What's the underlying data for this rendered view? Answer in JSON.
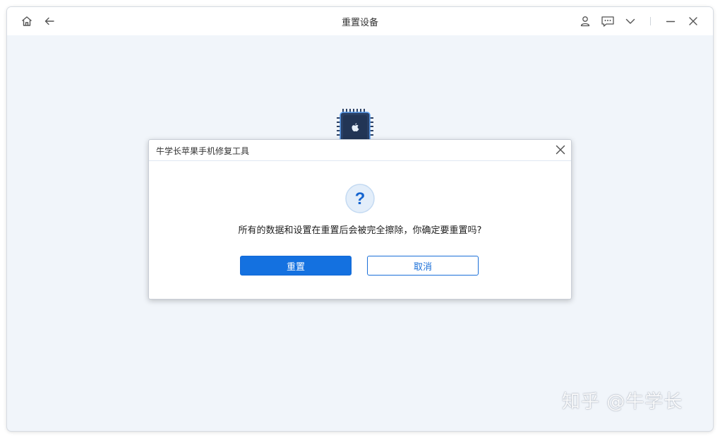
{
  "window": {
    "title": "重置设备"
  },
  "titlebar": {
    "icons": [
      "home-icon",
      "back-arrow-icon",
      "user-icon",
      "feedback-icon",
      "chevron-down-icon",
      "minimize-icon",
      "close-icon"
    ]
  },
  "dialog": {
    "title": "牛学长苹果手机修复工具",
    "message": "所有的数据和设置在重置后会被完全擦除，你确定要重置吗?",
    "question_mark": "?",
    "confirm_label": "重置",
    "cancel_label": "取消"
  },
  "watermark": {
    "text": "知乎 @牛学长"
  },
  "colors": {
    "accent": "#1471e0",
    "background": "#f1f5fa",
    "chip": "#2a3f63"
  }
}
